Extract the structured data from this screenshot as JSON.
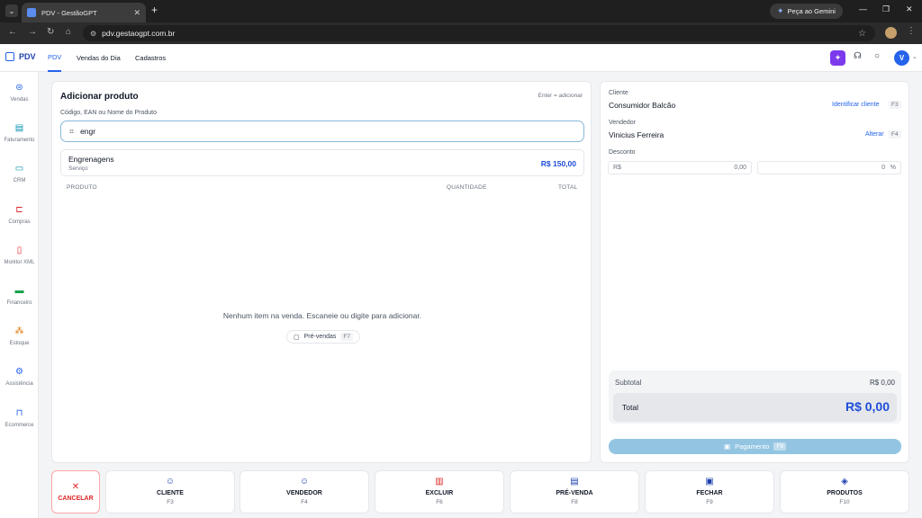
{
  "browser": {
    "tab_title": "PDV - GestãoGPT",
    "url": "pdv.gestaogpt.com.br",
    "gemini_label": "Peça ao Gemini"
  },
  "header": {
    "brand": "PDV",
    "nav": [
      "PDV",
      "Vendas do Dia",
      "Cadastros"
    ],
    "avatar_initial": "V"
  },
  "sidebar": {
    "items": [
      {
        "label": "Vendas",
        "icon": "basket-icon",
        "color": "#2563eb"
      },
      {
        "label": "Faturamento",
        "icon": "document-icon",
        "color": "#0891b2"
      },
      {
        "label": "CRM",
        "icon": "chat-icon",
        "color": "#0891b2"
      },
      {
        "label": "Compras",
        "icon": "cart-icon",
        "color": "#dc2626"
      },
      {
        "label": "Monitor XML",
        "icon": "file-xml-icon",
        "color": "#dc2626"
      },
      {
        "label": "Financeiro",
        "icon": "money-icon",
        "color": "#16a34a"
      },
      {
        "label": "Estoque",
        "icon": "boxes-icon",
        "color": "#d97706"
      },
      {
        "label": "Assistência",
        "icon": "tools-icon",
        "color": "#2563eb"
      },
      {
        "label": "Ecommerce",
        "icon": "bag-icon",
        "color": "#2563eb"
      }
    ]
  },
  "main": {
    "title": "Adicionar produto",
    "enter_hint": "Enter = adicionar",
    "search_label": "Código, EAN ou Nome do Produto",
    "search_value": "engr",
    "suggestion": {
      "name": "Engrenagens",
      "type": "Serviço",
      "price": "R$ 150,00"
    },
    "columns": [
      "PRODUTO",
      "QUANTIDADE",
      "TOTAL"
    ],
    "empty_message": "Nenhum item na venda. Escaneie ou digite para adicionar.",
    "prevendas_label": "Pré-vendas",
    "prevendas_key": "F7"
  },
  "side": {
    "cliente_label": "Cliente",
    "cliente_value": "Consumidor Balcão",
    "cliente_action": "Identificar cliente",
    "cliente_key": "F3",
    "vendedor_label": "Vendedor",
    "vendedor_value": "Vinicius Ferreira",
    "vendedor_action": "Alterar",
    "vendedor_key": "F4",
    "desconto_label": "Desconto",
    "desconto_currency": "R$",
    "desconto_value": "0,00",
    "desconto_percent": "0",
    "percent_sign": "%",
    "subtotal_label": "Subtotal",
    "subtotal_value": "R$ 0,00",
    "total_label": "Total",
    "total_value": "R$ 0,00",
    "pay_label": "Pagamento",
    "pay_key": "F9"
  },
  "actions": [
    {
      "label": "CANCELAR",
      "key": ""
    },
    {
      "label": "CLIENTE",
      "key": "F3"
    },
    {
      "label": "VENDEDOR",
      "key": "F4"
    },
    {
      "label": "EXCLUIR",
      "key": "F6"
    },
    {
      "label": "PRÉ-VENDA",
      "key": "F8"
    },
    {
      "label": "FECHAR",
      "key": "F9"
    },
    {
      "label": "PRODUTOS",
      "key": "F10"
    }
  ]
}
